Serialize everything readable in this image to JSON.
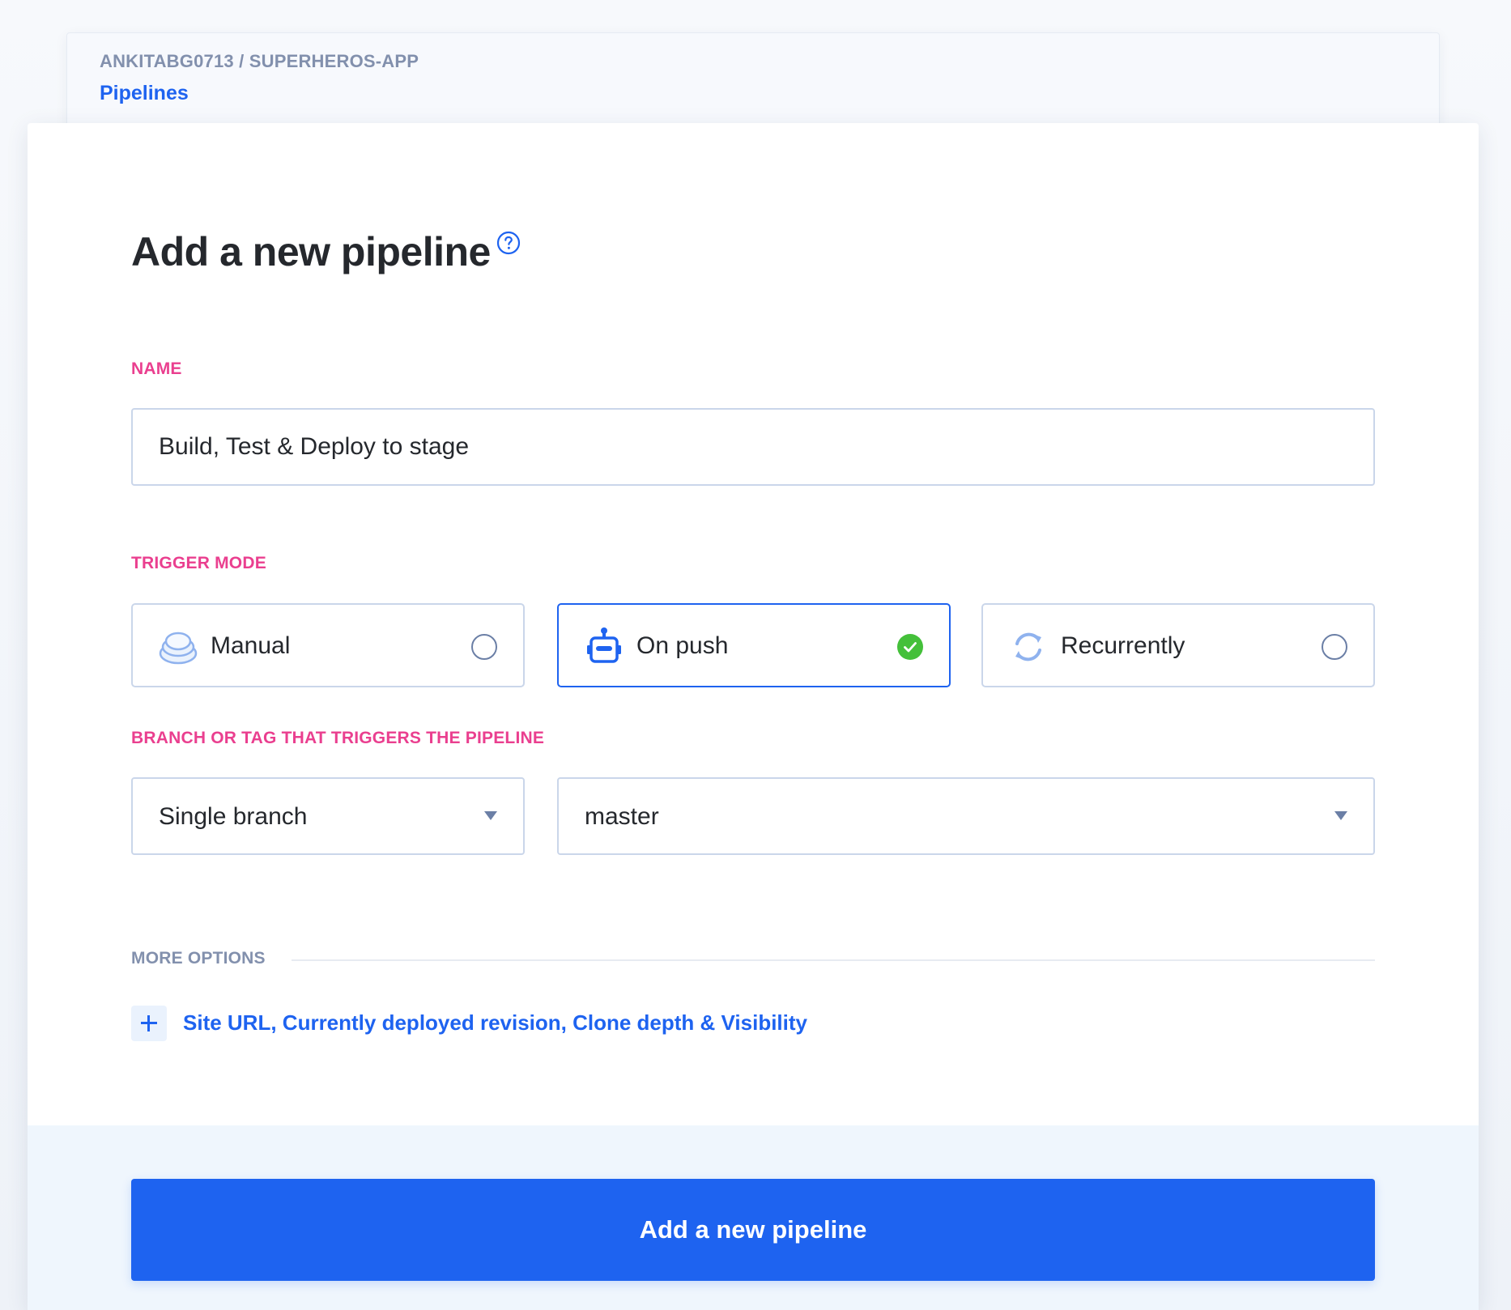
{
  "breadcrumb": {
    "path": "ANKITABG0713 / SUPERHEROS-APP",
    "link": "Pipelines"
  },
  "form": {
    "title": "Add a new pipeline",
    "help_icon": "question-circle-icon",
    "name": {
      "label": "NAME",
      "value": "Build, Test & Deploy to stage"
    },
    "trigger_mode": {
      "label": "TRIGGER MODE",
      "options": [
        {
          "label": "Manual",
          "icon": "hand-stack-icon",
          "selected": false
        },
        {
          "label": "On push",
          "icon": "robot-icon",
          "selected": true
        },
        {
          "label": "Recurrently",
          "icon": "refresh-icon",
          "selected": false
        }
      ]
    },
    "branch": {
      "label": "BRANCH OR TAG THAT TRIGGERS THE PIPELINE",
      "type_value": "Single branch",
      "branch_value": "master"
    },
    "more_options": {
      "label": "MORE OPTIONS",
      "link": "Site URL, Currently deployed revision, Clone depth & Visibility"
    },
    "submit_label": "Add a new pipeline"
  },
  "colors": {
    "accent": "#1e63f0",
    "label_pink": "#ea3f8f",
    "success": "#44c03a",
    "muted": "#8290ad"
  }
}
